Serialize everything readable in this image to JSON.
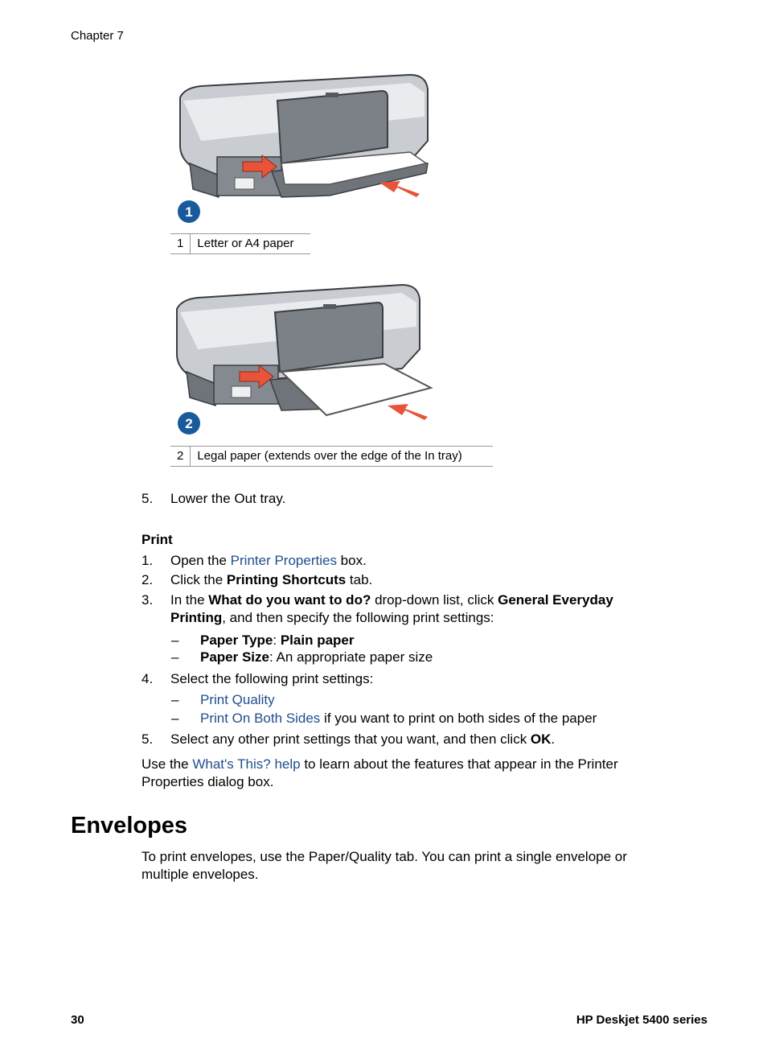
{
  "header": {
    "chapter": "Chapter 7"
  },
  "figures": [
    {
      "badge": "1",
      "caption_num": "1",
      "caption_text": "Letter or A4 paper"
    },
    {
      "badge": "2",
      "caption_num": "2",
      "caption_text": "Legal paper (extends over the edge of the In tray)"
    }
  ],
  "step5_top": {
    "num": "5.",
    "text": "Lower the Out tray."
  },
  "print_section": {
    "heading": "Print",
    "steps": [
      {
        "num": "1.",
        "pre": "Open the ",
        "link": "Printer Properties",
        "post": " box."
      },
      {
        "num": "2.",
        "pre": "Click the ",
        "bold": "Printing Shortcuts",
        "post": " tab."
      },
      {
        "num": "3.",
        "pre": "In the ",
        "bold1": "What do you want to do?",
        "mid": " drop-down list, click ",
        "bold2": "General Everyday",
        "line2_bold": "Printing",
        "line2_post": ", and then specify the following print settings:"
      },
      {
        "num": "4.",
        "text": "Select the following print settings:"
      },
      {
        "num": "5.",
        "pre": "Select any other print settings that you want, and then click ",
        "bold": "OK",
        "post": "."
      }
    ],
    "step3_subs": [
      {
        "dash": "–",
        "bold1": "Paper Type",
        "sep": ": ",
        "bold2": "Plain paper"
      },
      {
        "dash": "–",
        "bold": "Paper Size",
        "post": ": An appropriate paper size"
      }
    ],
    "step4_subs": [
      {
        "dash": "–",
        "link": "Print Quality"
      },
      {
        "dash": "–",
        "link": "Print On Both Sides",
        "post": " if you want to print on both sides of the paper"
      }
    ],
    "help_note": {
      "pre": "Use the ",
      "link": "What's This? help",
      "post": " to learn about the features that appear in the Printer",
      "line2": "Properties dialog box."
    }
  },
  "envelopes": {
    "heading": "Envelopes",
    "line1": "To print envelopes, use the Paper/Quality tab. You can print a single envelope or",
    "line2": "multiple envelopes."
  },
  "footer": {
    "page_number": "30",
    "product": "HP Deskjet 5400 series"
  },
  "colors": {
    "link": "#1f4e8c",
    "badge": "#1a5a9c",
    "arrow": "#e8533a"
  }
}
